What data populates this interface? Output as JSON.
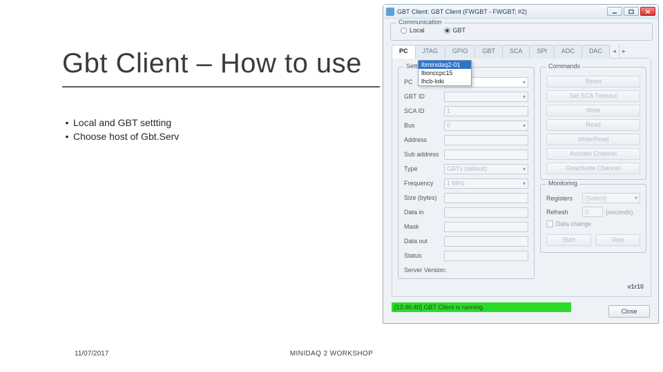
{
  "slide": {
    "title": "Gbt Client – How to use",
    "bullets": [
      "Local and GBT settting",
      "Choose host of Gbt.Serv"
    ],
    "footer_date": "11/07/2017",
    "footer_center": "MINIDAQ 2 WORKSHOP"
  },
  "window": {
    "title": "GBT Client: GBT Client (FWGBT - FWGBT; #2)",
    "comm": {
      "caption": "Communication",
      "opt_local": "Local",
      "opt_gbt": "GBT"
    },
    "tabs": [
      "PC",
      "JTAG",
      "GPIO",
      "GBT",
      "SCA",
      "SPI",
      "ADC",
      "DAC"
    ],
    "dropdown": {
      "options": [
        "lbminidaq2-01",
        "lbonccpc15",
        "lhcb-loki"
      ]
    },
    "settings": {
      "caption": "Settings",
      "rows": {
        "pc": "PC",
        "gbtid": "GBT ID",
        "scaid": "SCA ID",
        "bus": "Bus",
        "address": "Address",
        "subaddress": "Sub address",
        "type": "Type",
        "frequency": "Frequency",
        "size": "Size (bytes)",
        "datain": "Data in",
        "mask": "Mask",
        "dataout": "Data out",
        "status": "Status",
        "serverver": "Server Version:"
      },
      "values": {
        "scaid": "1",
        "bus": "0",
        "type": "GBTx (default)",
        "frequency": "1 MHz"
      }
    },
    "commands": {
      "caption": "Commands",
      "btns": [
        "Reset",
        "Set SCA Timeout",
        "Write",
        "Read",
        "Write/Read",
        "Activate Channel",
        "Deactivate Channel"
      ]
    },
    "monitoring": {
      "caption": "Monitoring",
      "registers_lbl": "Registers",
      "registers_val": "(Select)",
      "refresh_lbl": "Refresh",
      "refresh_val": "0",
      "refresh_unit": "(seconds)",
      "datachange": "Data change",
      "start": "Start",
      "view": "View"
    },
    "version": "v1r10",
    "status": "[13:46:40] GBT Client is running.",
    "close": "Close"
  }
}
